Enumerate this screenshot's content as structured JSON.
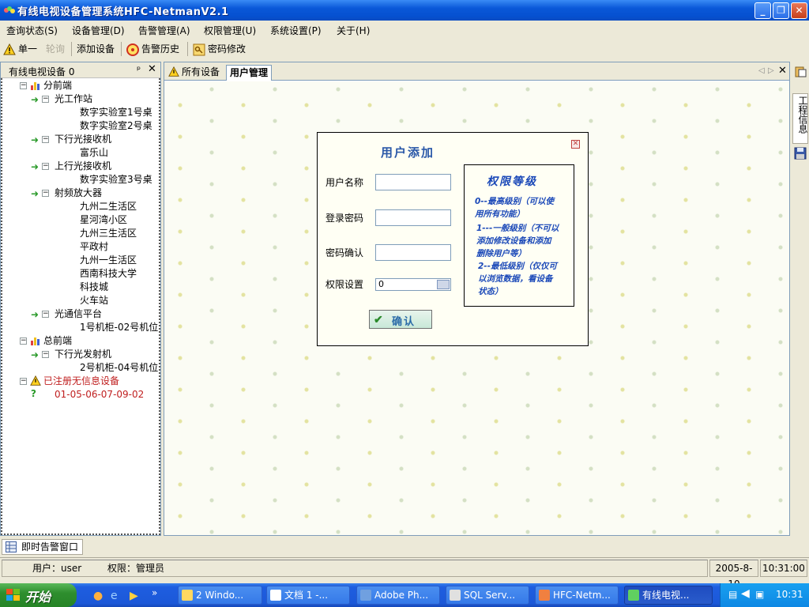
{
  "window": {
    "title": "有线电视设备管理系统HFC-NetmanV2.1"
  },
  "menu": [
    {
      "label": "查询状态(S)"
    },
    {
      "label": "设备管理(D)"
    },
    {
      "label": "告警管理(A)"
    },
    {
      "label": "权限管理(U)"
    },
    {
      "label": "系统设置(P)"
    },
    {
      "label": "关于(H)"
    }
  ],
  "toolbar": {
    "single": "单一",
    "poll": "轮询",
    "add_device": "添加设备",
    "alarm_history": "告警历史",
    "change_password": "密码修改"
  },
  "left_panel": {
    "title": "有线电视设备 0",
    "tree": [
      {
        "label": "分前端"
      },
      {
        "label": "光工作站"
      },
      {
        "label": "数字实验室1号桌"
      },
      {
        "label": "数字实验室2号桌"
      },
      {
        "label": "下行光接收机"
      },
      {
        "label": "富乐山"
      },
      {
        "label": "上行光接收机"
      },
      {
        "label": "数字实验室3号桌"
      },
      {
        "label": "射频放大器"
      },
      {
        "label": "九州二生活区"
      },
      {
        "label": "星河湾小区"
      },
      {
        "label": "九州三生活区"
      },
      {
        "label": "平政村"
      },
      {
        "label": "九州一生活区"
      },
      {
        "label": "西南科技大学"
      },
      {
        "label": "科技城"
      },
      {
        "label": "火车站"
      },
      {
        "label": "光通信平台"
      },
      {
        "label": "1号机柜-02号机位"
      },
      {
        "label": "总前端"
      },
      {
        "label": "下行光发射机"
      },
      {
        "label": "2号机柜-04号机位"
      },
      {
        "label": "已注册无信息设备"
      },
      {
        "label": "01-05-06-07-09-02"
      }
    ]
  },
  "tabs": [
    {
      "label": "所有设备"
    },
    {
      "label": "用户管理"
    }
  ],
  "right_bar": {
    "label": "工程信息"
  },
  "dialog": {
    "title": "用户添加",
    "username_label": "用户名称",
    "password_label": "登录密码",
    "confirm_label": "密码确认",
    "permission_label": "权限设置",
    "permission_value": "0",
    "ok_label": "确认",
    "perm_title": "权限等级",
    "perm_lines": [
      "0--最高级别（可以使",
      "用所有功能）",
      "1---一般级别（不可以",
      "添加修改设备和添加",
      "删除用户等）",
      "2--最低级别（仅仅可",
      "以浏览数据，看设备",
      "状态）"
    ]
  },
  "alarm_window": {
    "label": "即时告警窗口"
  },
  "status": {
    "user": "用户：user",
    "role": "权限：管理员",
    "date": "2005-8-10",
    "time": "10:31:00"
  },
  "taskbar": {
    "start": "开始",
    "items": [
      {
        "label": "2 Windo..."
      },
      {
        "label": "文档 1 -..."
      },
      {
        "label": "Adobe Ph..."
      },
      {
        "label": "SQL Serv..."
      },
      {
        "label": "HFC-Netm..."
      },
      {
        "label": "有线电视..."
      }
    ],
    "clock": "10:31"
  }
}
